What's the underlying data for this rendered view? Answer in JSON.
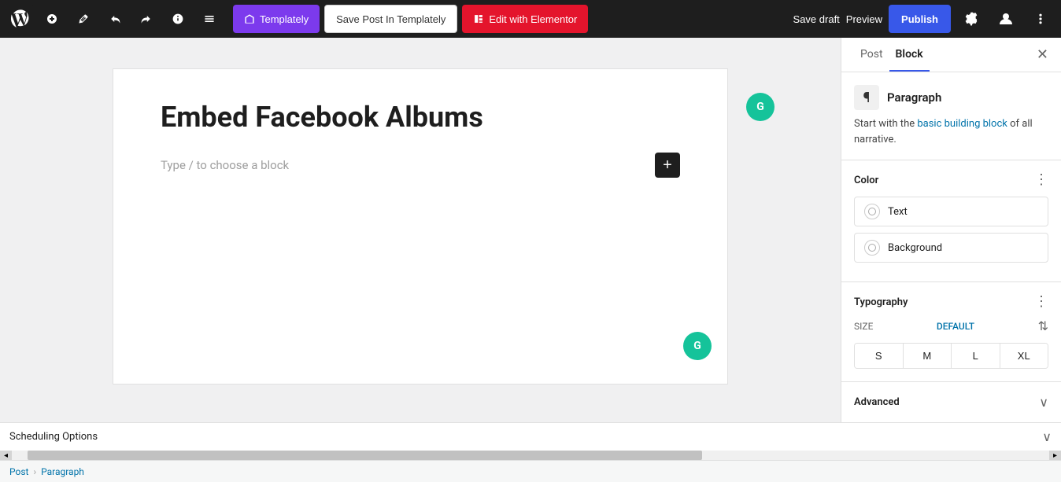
{
  "toolbar": {
    "templately_label": "Templately",
    "save_post_label": "Save Post In Templately",
    "elementor_label": "Edit with Elementor",
    "save_draft_label": "Save draft",
    "preview_label": "Preview",
    "publish_label": "Publish"
  },
  "editor": {
    "post_title": "Embed Facebook Albums",
    "block_placeholder": "Type / to choose a block"
  },
  "panel": {
    "post_tab": "Post",
    "block_tab": "Block",
    "paragraph_title": "Paragraph",
    "paragraph_desc_start": "Start with the ",
    "paragraph_desc_blue": "basic building block",
    "paragraph_desc_end": " of all narrative.",
    "color_section_title": "Color",
    "text_label": "Text",
    "background_label": "Background",
    "typography_title": "Typography",
    "size_label": "SIZE",
    "size_value": "DEFAULT",
    "size_s": "S",
    "size_m": "M",
    "size_l": "L",
    "size_xl": "XL",
    "advanced_label": "Advanced"
  },
  "bottom": {
    "scheduling_label": "Scheduling Options",
    "breadcrumb_post": "Post",
    "breadcrumb_paragraph": "Paragraph"
  }
}
